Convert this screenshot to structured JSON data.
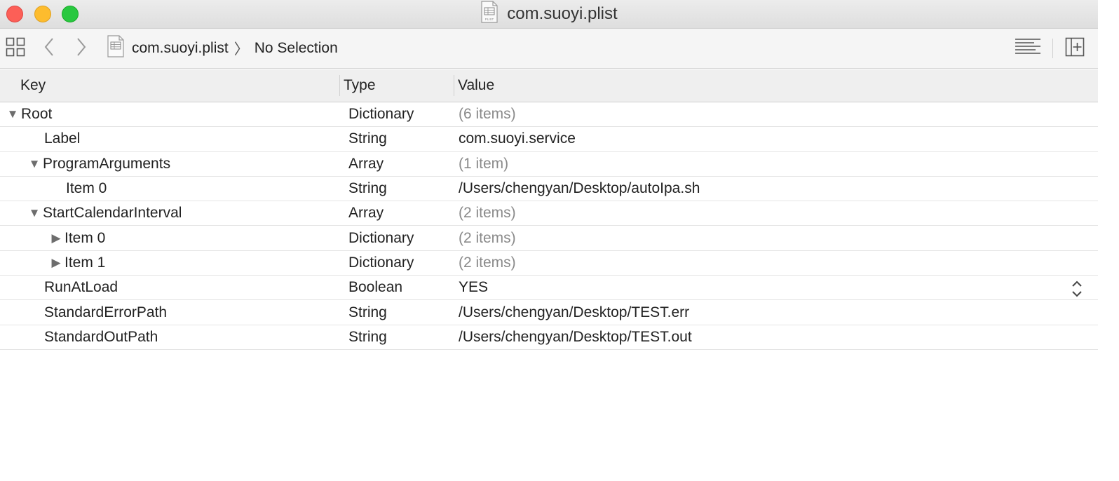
{
  "window": {
    "title": "com.suoyi.plist",
    "doc_icon_label": "PLIST"
  },
  "toolbar": {
    "breadcrumb_file": "com.suoyi.plist",
    "breadcrumb_separator": "〉",
    "breadcrumb_selection": "No Selection"
  },
  "table": {
    "headers": {
      "key": "Key",
      "type": "Type",
      "value": "Value"
    },
    "rows": [
      {
        "key": "Root",
        "type": "Dictionary",
        "value": "(6 items)"
      },
      {
        "key": "Label",
        "type": "String",
        "value": "com.suoyi.service"
      },
      {
        "key": "ProgramArguments",
        "type": "Array",
        "value": "(1 item)"
      },
      {
        "key": "Item 0",
        "type": "String",
        "value": "/Users/chengyan/Desktop/autoIpa.sh"
      },
      {
        "key": "StartCalendarInterval",
        "type": "Array",
        "value": "(2 items)"
      },
      {
        "key": "Item 0",
        "type": "Dictionary",
        "value": "(2 items)"
      },
      {
        "key": "Item 1",
        "type": "Dictionary",
        "value": "(2 items)"
      },
      {
        "key": "RunAtLoad",
        "type": "Boolean",
        "value": "YES"
      },
      {
        "key": "StandardErrorPath",
        "type": "String",
        "value": "/Users/chengyan/Desktop/TEST.err"
      },
      {
        "key": "StandardOutPath",
        "type": "String",
        "value": "/Users/chengyan/Desktop/TEST.out"
      }
    ]
  },
  "icons": {
    "close": "close-button",
    "minimize": "minimize-button",
    "zoom": "zoom-button",
    "related_items": "grid-icon",
    "back": "chevron-left-icon",
    "forward": "chevron-right-icon",
    "editor_options": "lines-icon",
    "inspector": "add-panel-icon",
    "expanded": "triangle-down-icon",
    "collapsed": "triangle-right-icon",
    "stepper": "up-down-stepper-icon"
  },
  "colors": {
    "close": "#fc5f57",
    "minimize": "#fdbc2e",
    "zoom": "#29c840",
    "muted_value": "#8a8a8a"
  }
}
